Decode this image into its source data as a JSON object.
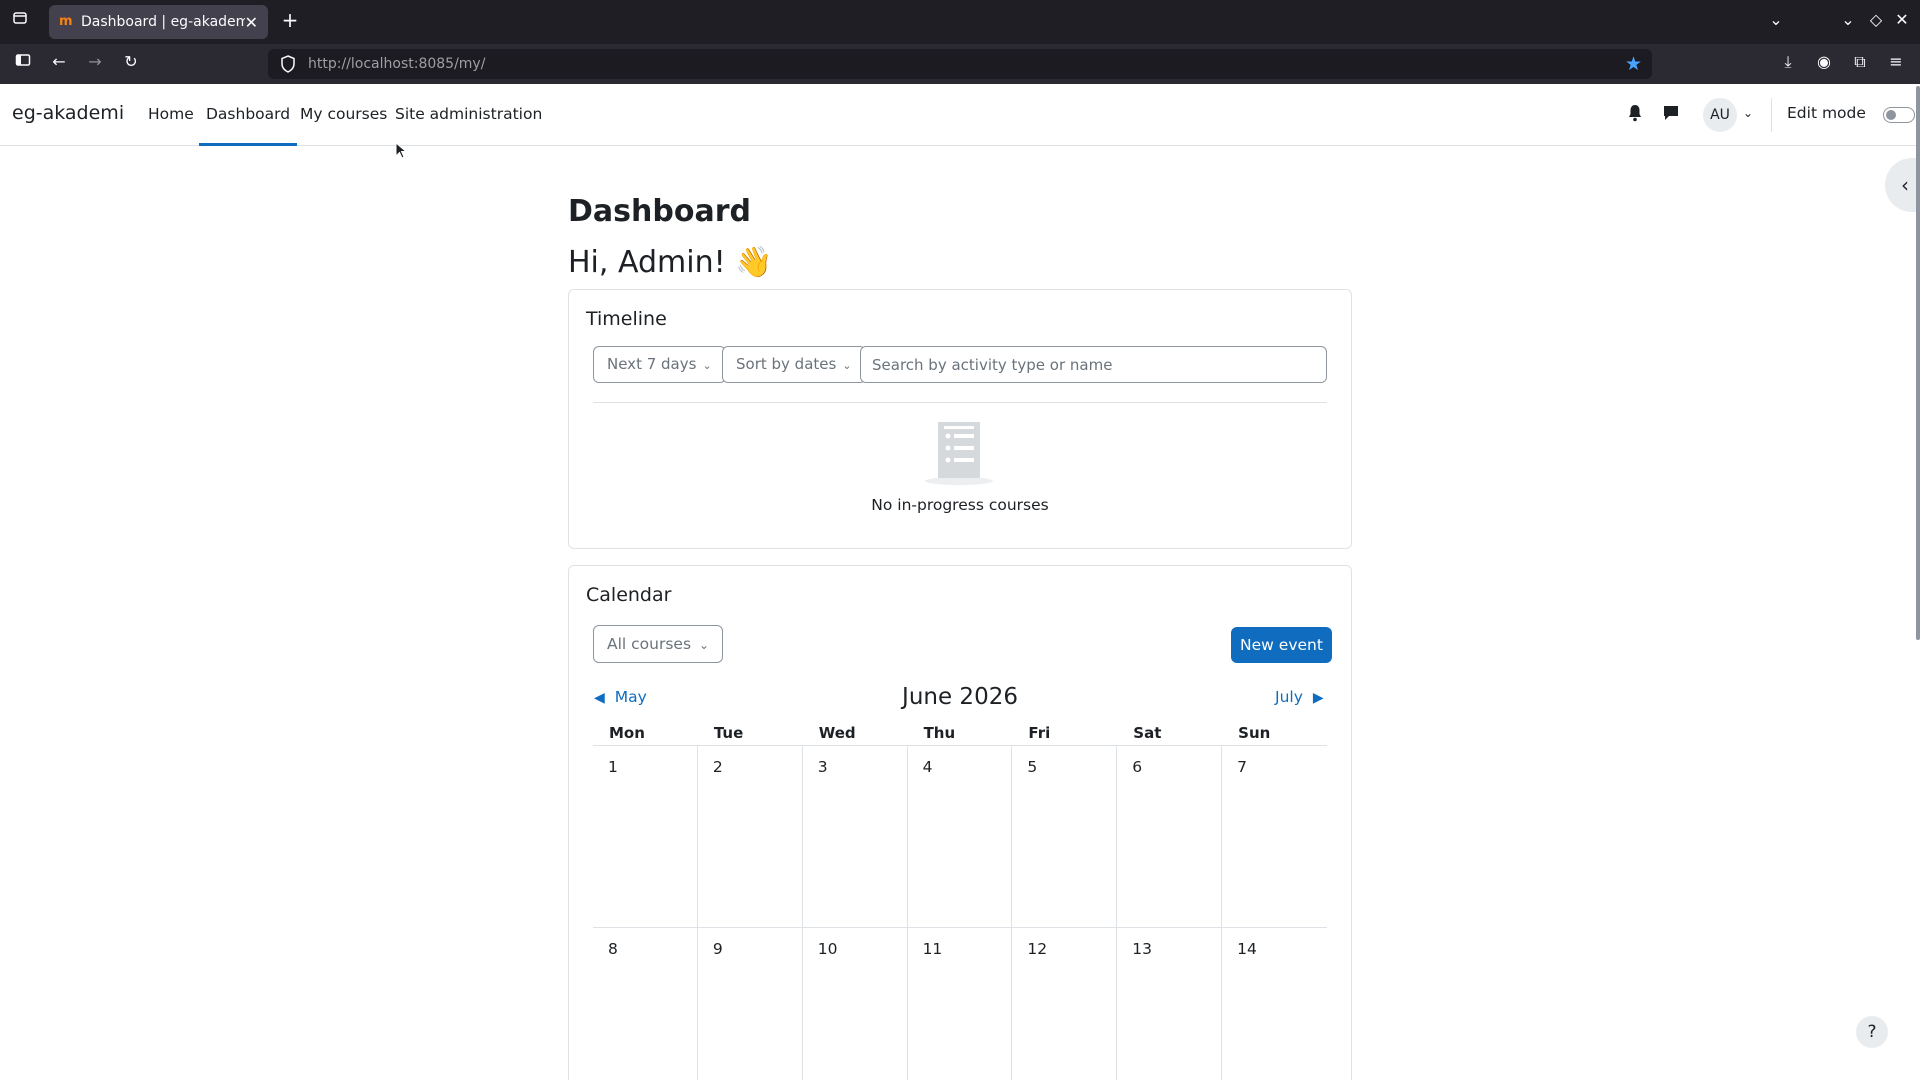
{
  "browser": {
    "tab_title": "Dashboard | eg-akademi",
    "url_host": "http://localhost",
    "url_rest": ":8085/my/"
  },
  "navbar": {
    "brand": "eg-akademi",
    "links": [
      "Home",
      "Dashboard",
      "My courses",
      "Site administration"
    ],
    "avatar_initials": "AU",
    "edit_mode_label": "Edit mode"
  },
  "page": {
    "title": "Dashboard",
    "greeting": "Hi, Admin! 👋"
  },
  "timeline": {
    "title": "Timeline",
    "filter_label": "Next 7 days",
    "sort_label": "Sort by dates",
    "search_placeholder": "Search by activity type or name",
    "empty_text": "No in-progress courses"
  },
  "calendar": {
    "title": "Calendar",
    "course_filter": "All courses",
    "new_event_label": "New event",
    "prev_month": "May",
    "next_month": "July",
    "current_month": "June 2026",
    "weekdays": [
      "Mon",
      "Tue",
      "Wed",
      "Thu",
      "Fri",
      "Sat",
      "Sun"
    ],
    "weeks": [
      [
        "1",
        "2",
        "3",
        "4",
        "5",
        "6",
        "7"
      ],
      [
        "8",
        "9",
        "10",
        "11",
        "12",
        "13",
        "14"
      ]
    ]
  },
  "help_label": "?",
  "colors": {
    "primary": "#0f6cbf",
    "border": "#dee2e6",
    "text": "#1d2125"
  }
}
